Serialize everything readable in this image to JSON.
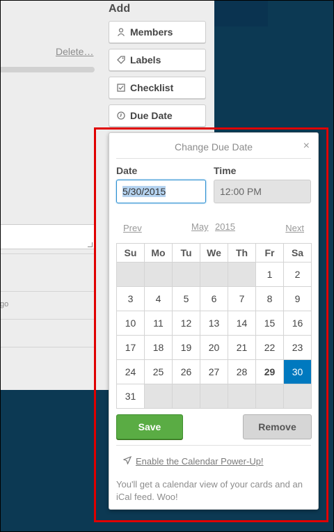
{
  "card": {
    "delete_label": "Delete…",
    "activity_snippet": "go"
  },
  "add_section": {
    "heading": "Add",
    "buttons": [
      {
        "label": "Members",
        "icon": "person-icon"
      },
      {
        "label": "Labels",
        "icon": "tag-icon"
      },
      {
        "label": "Checklist",
        "icon": "checkbox-icon"
      },
      {
        "label": "Due Date",
        "icon": "clock-icon"
      }
    ]
  },
  "popover": {
    "title": "Change Due Date",
    "close_symbol": "×",
    "date_label": "Date",
    "date_value": "5/30/2015",
    "time_label": "Time",
    "time_value": "12:00 PM",
    "nav": {
      "prev": "Prev",
      "month": "May",
      "year": "2015",
      "next": "Next"
    },
    "weekdays": [
      "Su",
      "Mo",
      "Tu",
      "We",
      "Th",
      "Fr",
      "Sa"
    ],
    "weeks": [
      [
        "",
        "",
        "",
        "",
        "",
        "1",
        "2"
      ],
      [
        "3",
        "4",
        "5",
        "6",
        "7",
        "8",
        "9"
      ],
      [
        "10",
        "11",
        "12",
        "13",
        "14",
        "15",
        "16"
      ],
      [
        "17",
        "18",
        "19",
        "20",
        "21",
        "22",
        "23"
      ],
      [
        "24",
        "25",
        "26",
        "27",
        "28",
        "29",
        "30"
      ],
      [
        "31",
        "",
        "",
        "",
        "",
        "",
        ""
      ]
    ],
    "today": "29",
    "selected": "30",
    "save_label": "Save",
    "remove_label": "Remove",
    "powerup_link": "Enable the Calendar Power-Up!",
    "powerup_desc": "You'll get a calendar view of your cards and an iCal feed. Woo!"
  },
  "colors": {
    "board_bg": "#0c3953",
    "selected_day": "#0079bf",
    "save_button": "#5aac44",
    "highlight_border": "#e00000"
  }
}
